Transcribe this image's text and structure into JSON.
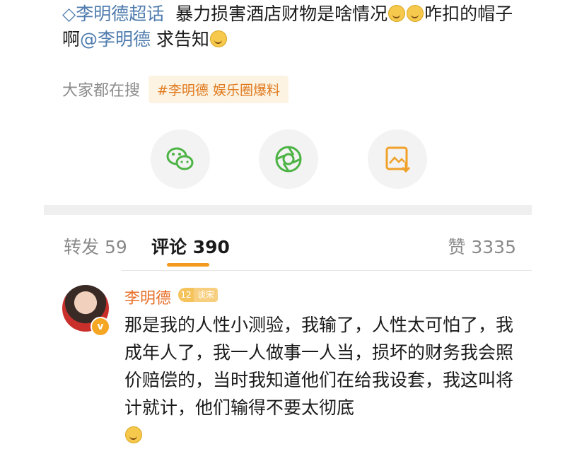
{
  "post": {
    "topic_icon": "diamond-icon",
    "topic": "李明德超话",
    "text_a": "暴力损害酒店财物是啥情况",
    "text_b": "咋扣的帽子啊",
    "mention": "@李明德",
    "text_c": "求告知",
    "emojis": [
      "laugh-cry-emoji",
      "laugh-cry-emoji",
      "dizzy-emoji"
    ]
  },
  "search": {
    "label": "大家都在搜",
    "tag": "#李明德 娱乐圈爆料"
  },
  "share": {
    "icons": [
      "wechat-icon",
      "moments-icon",
      "save-image-icon"
    ],
    "colors": {
      "icon": "#4cb344",
      "save": "#f0a12a"
    }
  },
  "tabs": {
    "repost": "转发 59",
    "comments": "评论 390",
    "likes": "赞 3335",
    "accent": "#f39a1e"
  },
  "comment": {
    "username": "李明德",
    "level": "12",
    "level_text": "谈宋",
    "verified_badge": "v",
    "text": "那是我的人性小测验，我输了，人性太可怕了，我成年人了，我一人做事一人当，损坏的财务我会照价赔偿的，当时我知道他们在给我设套，我这叫将计就计，他们输得不要太彻底",
    "emoji": "grin-emoji"
  }
}
